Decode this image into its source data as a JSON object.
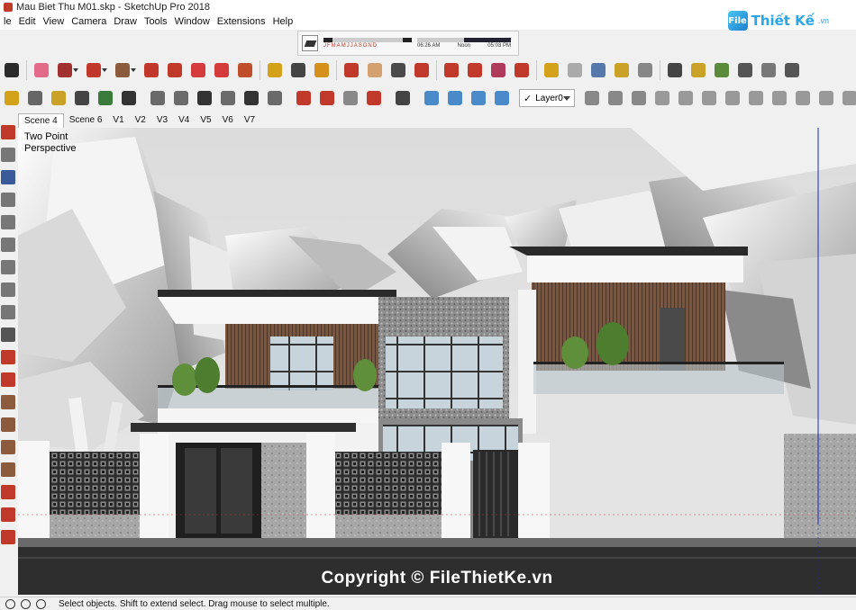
{
  "window": {
    "title": "Mau Biet Thu M01.skp - SketchUp Pro 2018"
  },
  "menu": [
    "le",
    "Edit",
    "View",
    "Camera",
    "Draw",
    "Tools",
    "Window",
    "Extensions",
    "Help"
  ],
  "logo": {
    "mark": "File",
    "text": "Thiết Kế",
    "suffix": ".vn"
  },
  "shadow_panel": {
    "months": [
      "J",
      "F",
      "M",
      "A",
      "M",
      "J",
      "J",
      "A",
      "S",
      "O",
      "N",
      "D"
    ],
    "time_start": "06:26 AM",
    "time_mid": "Noon",
    "time_end": "05:03 PM"
  },
  "layer": {
    "name": "Layer0",
    "checked": "✓"
  },
  "scenes": [
    {
      "label": "Scene 4",
      "active": true
    },
    {
      "label": "Scene 6",
      "active": false
    },
    {
      "label": "V1",
      "active": false
    },
    {
      "label": "V2",
      "active": false
    },
    {
      "label": "V3",
      "active": false
    },
    {
      "label": "V4",
      "active": false
    },
    {
      "label": "V5",
      "active": false
    },
    {
      "label": "V6",
      "active": false
    },
    {
      "label": "V7",
      "active": false
    }
  ],
  "viewport": {
    "label_line1": "Two Point",
    "label_line2": "Perspective",
    "watermark": "Copyright © FileThietKe.vn"
  },
  "status": {
    "message": "Select objects. Shift to extend select. Drag mouse to select multiple."
  },
  "toolbar1": [
    {
      "icon": "select-arrow-icon",
      "color": "#2b2b2b"
    },
    {
      "icon": "eraser-icon",
      "color": "#e46a8a"
    },
    {
      "icon": "pencil-line-icon",
      "color": "#a23030"
    },
    {
      "icon": "arc-icon",
      "color": "#c0392b"
    },
    {
      "icon": "rectangle-icon",
      "color": "#8c5a3c"
    },
    {
      "icon": "push-pull-icon",
      "color": "#c0392b"
    },
    {
      "icon": "offset-icon",
      "color": "#c0392b"
    },
    {
      "icon": "move-icon",
      "color": "#d43b3b"
    },
    {
      "icon": "rotate-icon",
      "color": "#d43b3b"
    },
    {
      "icon": "scale-icon",
      "color": "#c04e2b"
    },
    {
      "icon": "tape-measure-icon",
      "color": "#d4a21a"
    },
    {
      "icon": "text-label-icon",
      "color": "#444444"
    },
    {
      "icon": "paint-bucket-icon",
      "color": "#d4901a"
    },
    {
      "icon": "orbit-icon",
      "color": "#c0392b"
    },
    {
      "icon": "pan-hand-icon",
      "color": "#d4a070"
    },
    {
      "icon": "zoom-icon",
      "color": "#4a4a4a"
    },
    {
      "icon": "zoom-extents-icon",
      "color": "#c0392b"
    },
    {
      "icon": "warehouse-icon",
      "color": "#c0392b"
    },
    {
      "icon": "share-model-icon",
      "color": "#c0392b"
    },
    {
      "icon": "extension-warehouse-icon",
      "color": "#b03a5b"
    },
    {
      "icon": "ruby-icon",
      "color": "#c0392b"
    },
    {
      "icon": "shield-icon",
      "color": "#d4a21a"
    },
    {
      "icon": "refresh-icon",
      "color": "#aaaaaa"
    },
    {
      "icon": "printer-icon",
      "color": "#5577aa"
    },
    {
      "icon": "key-icon",
      "color": "#c9a227"
    },
    {
      "icon": "camera-icon",
      "color": "#888888"
    },
    {
      "icon": "goggles-icon",
      "color": "#444444"
    },
    {
      "icon": "add-component-icon",
      "color": "#c9a227"
    },
    {
      "icon": "tree-icon",
      "color": "#5a8a3a"
    },
    {
      "icon": "render-icon",
      "color": "#555555"
    },
    {
      "icon": "gear-icon",
      "color": "#777777"
    },
    {
      "icon": "sound-icon",
      "color": "#555555"
    }
  ],
  "toolbar2": [
    {
      "icon": "tape-icon",
      "color": "#d4a21a"
    },
    {
      "icon": "dimension-icon",
      "color": "#666666"
    },
    {
      "icon": "protractor-icon",
      "color": "#c9a227"
    },
    {
      "icon": "text-icon",
      "color": "#444444"
    },
    {
      "icon": "axes-icon",
      "color": "#3a7a3a"
    },
    {
      "icon": "3d-text-icon",
      "color": "#333333"
    },
    {
      "icon": "iso-view-icon",
      "color": "#6a6a6a"
    },
    {
      "icon": "top-view-icon",
      "color": "#6a6a6a"
    },
    {
      "icon": "front-view-icon",
      "color": "#333333"
    },
    {
      "icon": "right-view-icon",
      "color": "#6a6a6a"
    },
    {
      "icon": "back-view-icon",
      "color": "#333333"
    },
    {
      "icon": "left-view-icon",
      "color": "#6a6a6a"
    },
    {
      "icon": "section-plane-icon",
      "color": "#c0392b"
    },
    {
      "icon": "display-section-icon",
      "color": "#c0392b"
    },
    {
      "icon": "section-cuts-icon",
      "color": "#888888"
    },
    {
      "icon": "section-fill-icon",
      "color": "#c0392b"
    },
    {
      "icon": "position-camera-icon",
      "color": "#444444"
    },
    {
      "icon": "xray-icon",
      "color": "#4a8ac9"
    },
    {
      "icon": "back-edges-icon",
      "color": "#4a8ac9"
    },
    {
      "icon": "wireframe-icon",
      "color": "#4a8ac9"
    },
    {
      "icon": "hidden-line-icon",
      "color": "#4a8ac9"
    },
    {
      "icon": "shaded-icon",
      "color": "#888888"
    },
    {
      "icon": "shaded-textures-icon",
      "color": "#888888"
    },
    {
      "icon": "monochrome-icon",
      "color": "#888888"
    },
    {
      "icon": "style-a-icon",
      "color": "#999999"
    },
    {
      "icon": "style-b-icon",
      "color": "#999999"
    },
    {
      "icon": "style-c-icon",
      "color": "#999999"
    },
    {
      "icon": "style-d-icon",
      "color": "#999999"
    },
    {
      "icon": "style-e-icon",
      "color": "#999999"
    },
    {
      "icon": "style-f-icon",
      "color": "#999999"
    },
    {
      "icon": "style-g-icon",
      "color": "#999999"
    },
    {
      "icon": "style-h-icon",
      "color": "#999999"
    },
    {
      "icon": "style-i-icon",
      "color": "#999999"
    }
  ],
  "lefttools": [
    {
      "icon": "add-location-icon",
      "color": "#c0392b"
    },
    {
      "icon": "open-folder-icon",
      "color": "#777777"
    },
    {
      "icon": "save-icon",
      "color": "#3a5a9a"
    },
    {
      "icon": "cut-icon",
      "color": "#777777"
    },
    {
      "icon": "copy-icon",
      "color": "#777777"
    },
    {
      "icon": "paste-icon",
      "color": "#777777"
    },
    {
      "icon": "delete-icon",
      "color": "#777777"
    },
    {
      "icon": "undo-icon",
      "color": "#777777"
    },
    {
      "icon": "redo-icon",
      "color": "#777777"
    },
    {
      "icon": "print-icon",
      "color": "#555555"
    },
    {
      "icon": "model-info-icon",
      "color": "#c0392b"
    },
    {
      "icon": "freehand-icon",
      "color": "#c0392b"
    },
    {
      "icon": "rectangle-tool-icon",
      "color": "#8c5a3c"
    },
    {
      "icon": "rotated-rectangle-icon",
      "color": "#8c5a3c"
    },
    {
      "icon": "circle-icon",
      "color": "#8c5a3c"
    },
    {
      "icon": "polygon-icon",
      "color": "#8c5a3c"
    },
    {
      "icon": "arc-tool-icon",
      "color": "#c0392b"
    },
    {
      "icon": "pie-icon",
      "color": "#c0392b"
    },
    {
      "icon": "three-point-arc-icon",
      "color": "#c0392b"
    }
  ]
}
